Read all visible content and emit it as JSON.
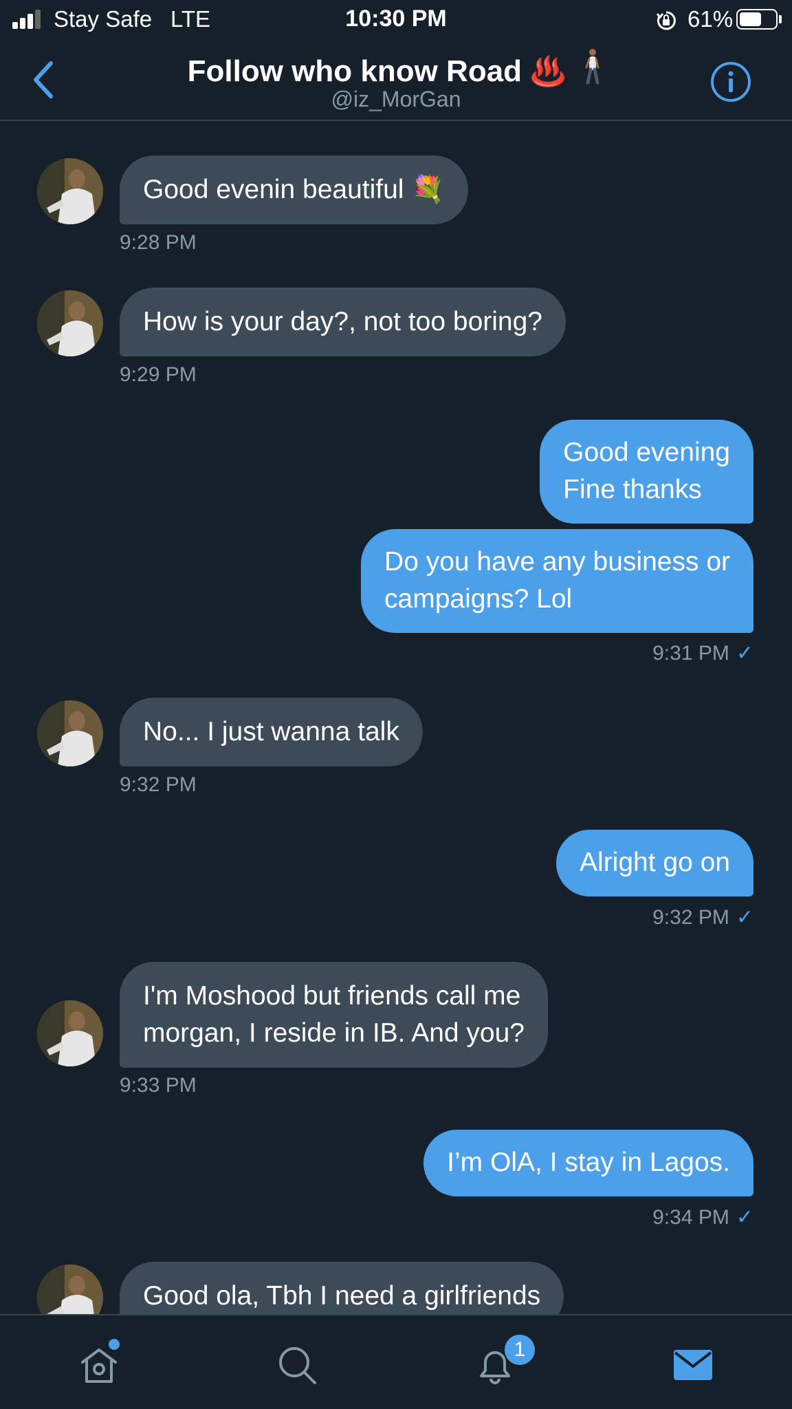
{
  "status_bar": {
    "carrier": "Stay Safe",
    "network": "LTE",
    "time": "10:30 PM",
    "battery_percent": "61%",
    "battery_level": 0.61,
    "signal_bars": 3
  },
  "header": {
    "title": "Follow who know Road",
    "title_emoji": "♨️",
    "handle": "@iz_MorGan"
  },
  "messages": [
    {
      "side": "in",
      "text": "Good evenin beautiful 💐",
      "time": "9:28 PM"
    },
    {
      "side": "in",
      "text": "How is your day?, not too boring?",
      "time": "9:29 PM"
    },
    {
      "side": "out",
      "text_lines": [
        "Good evening",
        "Fine thanks"
      ]
    },
    {
      "side": "out",
      "text_lines": [
        "Do you have any business or",
        "campaigns? Lol"
      ],
      "time": "9:31 PM"
    },
    {
      "side": "in",
      "text": "No... I just wanna talk",
      "time": "9:32 PM"
    },
    {
      "side": "out",
      "text": "Alright go on",
      "time": "9:32 PM"
    },
    {
      "side": "in",
      "text_lines": [
        "I'm Moshood but friends call me",
        "morgan, I reside in IB. And you?"
      ],
      "time": "9:33 PM"
    },
    {
      "side": "out",
      "text": "I’m OlA, I stay in Lagos.",
      "time": "9:34 PM"
    },
    {
      "side": "in",
      "text": "Good ola, Tbh I need a girlfriends"
    }
  ],
  "read_mark": "✓",
  "tab_bar": {
    "tabs": [
      "home-icon",
      "search-icon",
      "notifications-icon",
      "messages-icon"
    ],
    "notification_badge": "1",
    "accent": "#4c9fe9"
  },
  "colors": {
    "background": "#15202b",
    "incoming_bubble": "#3d4a57",
    "outgoing_bubble": "#4c9fe9",
    "secondary_text": "#8899a6"
  }
}
